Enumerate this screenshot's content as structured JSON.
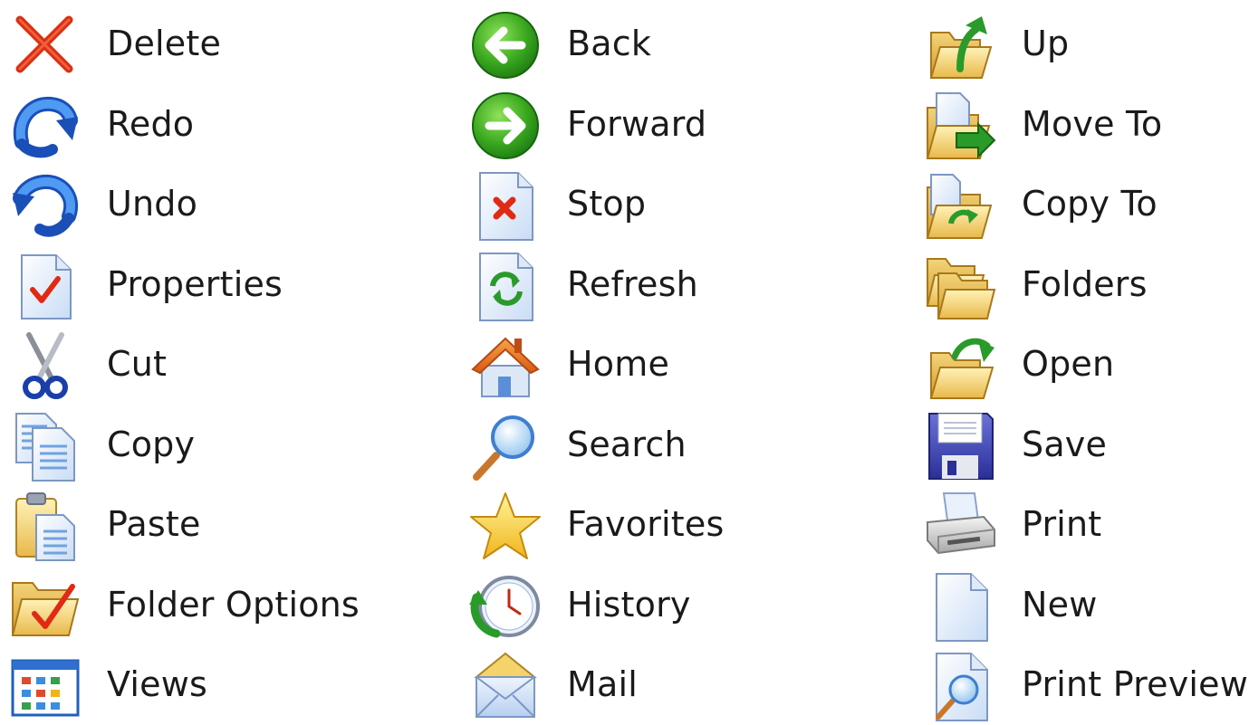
{
  "columns": [
    {
      "items": [
        {
          "label": "Delete",
          "icon": "delete-icon"
        },
        {
          "label": "Redo",
          "icon": "redo-icon"
        },
        {
          "label": "Undo",
          "icon": "undo-icon"
        },
        {
          "label": "Properties",
          "icon": "properties-icon"
        },
        {
          "label": "Cut",
          "icon": "cut-icon"
        },
        {
          "label": "Copy",
          "icon": "copy-icon"
        },
        {
          "label": "Paste",
          "icon": "paste-icon"
        },
        {
          "label": "Folder Options",
          "icon": "folder-options-icon"
        },
        {
          "label": "Views",
          "icon": "views-icon"
        }
      ]
    },
    {
      "items": [
        {
          "label": "Back",
          "icon": "back-icon"
        },
        {
          "label": "Forward",
          "icon": "forward-icon"
        },
        {
          "label": "Stop",
          "icon": "stop-icon"
        },
        {
          "label": "Refresh",
          "icon": "refresh-icon"
        },
        {
          "label": "Home",
          "icon": "home-icon"
        },
        {
          "label": "Search",
          "icon": "search-icon"
        },
        {
          "label": "Favorites",
          "icon": "favorites-icon"
        },
        {
          "label": "History",
          "icon": "history-icon"
        },
        {
          "label": "Mail",
          "icon": "mail-icon"
        }
      ]
    },
    {
      "items": [
        {
          "label": "Up",
          "icon": "up-icon"
        },
        {
          "label": "Move To",
          "icon": "move-to-icon"
        },
        {
          "label": "Copy To",
          "icon": "copy-to-icon"
        },
        {
          "label": "Folders",
          "icon": "folders-icon"
        },
        {
          "label": "Open",
          "icon": "open-icon"
        },
        {
          "label": "Save",
          "icon": "save-icon"
        },
        {
          "label": "Print",
          "icon": "print-icon"
        },
        {
          "label": "New",
          "icon": "new-icon"
        },
        {
          "label": "Print Preview",
          "icon": "print-preview-icon"
        }
      ]
    }
  ]
}
